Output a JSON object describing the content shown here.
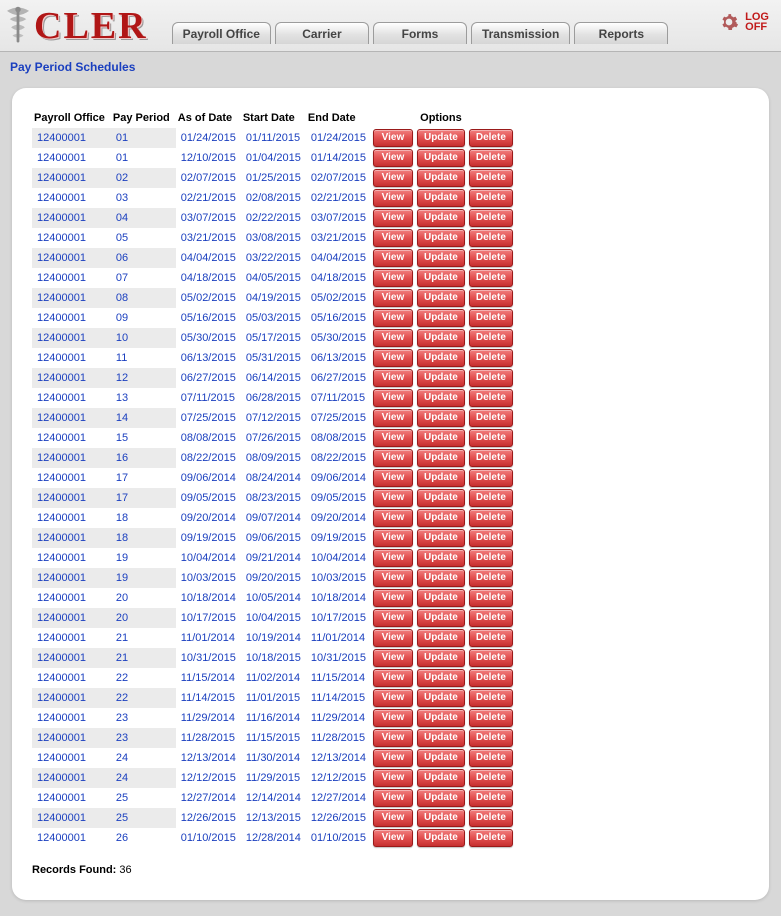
{
  "header": {
    "appName": "CLER",
    "tabs": [
      "Payroll Office",
      "Carrier",
      "Forms",
      "Transmission",
      "Reports"
    ],
    "logoff": "LOG\nOFF"
  },
  "page": {
    "subtitle": "Pay Period Schedules",
    "columns": {
      "payrollOffice": "Payroll Office",
      "payPeriod": "Pay Period",
      "asOf": "As of Date",
      "start": "Start Date",
      "end": "End Date",
      "options": "Options"
    },
    "buttons": {
      "view": "View",
      "update": "Update",
      "delete": "Delete"
    },
    "recordsLabel": "Records Found:",
    "recordsCount": "36",
    "rows": [
      {
        "po": "12400001",
        "pp": "01",
        "asof": "01/24/2015",
        "start": "01/11/2015",
        "end": "01/24/2015",
        "alt": true
      },
      {
        "po": "12400001",
        "pp": "01",
        "asof": "12/10/2015",
        "start": "01/04/2015",
        "end": "01/14/2015",
        "alt": false
      },
      {
        "po": "12400001",
        "pp": "02",
        "asof": "02/07/2015",
        "start": "01/25/2015",
        "end": "02/07/2015",
        "alt": true
      },
      {
        "po": "12400001",
        "pp": "03",
        "asof": "02/21/2015",
        "start": "02/08/2015",
        "end": "02/21/2015",
        "alt": false
      },
      {
        "po": "12400001",
        "pp": "04",
        "asof": "03/07/2015",
        "start": "02/22/2015",
        "end": "03/07/2015",
        "alt": true
      },
      {
        "po": "12400001",
        "pp": "05",
        "asof": "03/21/2015",
        "start": "03/08/2015",
        "end": "03/21/2015",
        "alt": false
      },
      {
        "po": "12400001",
        "pp": "06",
        "asof": "04/04/2015",
        "start": "03/22/2015",
        "end": "04/04/2015",
        "alt": true
      },
      {
        "po": "12400001",
        "pp": "07",
        "asof": "04/18/2015",
        "start": "04/05/2015",
        "end": "04/18/2015",
        "alt": false
      },
      {
        "po": "12400001",
        "pp": "08",
        "asof": "05/02/2015",
        "start": "04/19/2015",
        "end": "05/02/2015",
        "alt": true
      },
      {
        "po": "12400001",
        "pp": "09",
        "asof": "05/16/2015",
        "start": "05/03/2015",
        "end": "05/16/2015",
        "alt": false
      },
      {
        "po": "12400001",
        "pp": "10",
        "asof": "05/30/2015",
        "start": "05/17/2015",
        "end": "05/30/2015",
        "alt": true
      },
      {
        "po": "12400001",
        "pp": "11",
        "asof": "06/13/2015",
        "start": "05/31/2015",
        "end": "06/13/2015",
        "alt": false
      },
      {
        "po": "12400001",
        "pp": "12",
        "asof": "06/27/2015",
        "start": "06/14/2015",
        "end": "06/27/2015",
        "alt": true
      },
      {
        "po": "12400001",
        "pp": "13",
        "asof": "07/11/2015",
        "start": "06/28/2015",
        "end": "07/11/2015",
        "alt": false
      },
      {
        "po": "12400001",
        "pp": "14",
        "asof": "07/25/2015",
        "start": "07/12/2015",
        "end": "07/25/2015",
        "alt": true
      },
      {
        "po": "12400001",
        "pp": "15",
        "asof": "08/08/2015",
        "start": "07/26/2015",
        "end": "08/08/2015",
        "alt": false
      },
      {
        "po": "12400001",
        "pp": "16",
        "asof": "08/22/2015",
        "start": "08/09/2015",
        "end": "08/22/2015",
        "alt": true
      },
      {
        "po": "12400001",
        "pp": "17",
        "asof": "09/06/2014",
        "start": "08/24/2014",
        "end": "09/06/2014",
        "alt": false
      },
      {
        "po": "12400001",
        "pp": "17",
        "asof": "09/05/2015",
        "start": "08/23/2015",
        "end": "09/05/2015",
        "alt": true
      },
      {
        "po": "12400001",
        "pp": "18",
        "asof": "09/20/2014",
        "start": "09/07/2014",
        "end": "09/20/2014",
        "alt": false
      },
      {
        "po": "12400001",
        "pp": "18",
        "asof": "09/19/2015",
        "start": "09/06/2015",
        "end": "09/19/2015",
        "alt": true
      },
      {
        "po": "12400001",
        "pp": "19",
        "asof": "10/04/2014",
        "start": "09/21/2014",
        "end": "10/04/2014",
        "alt": false
      },
      {
        "po": "12400001",
        "pp": "19",
        "asof": "10/03/2015",
        "start": "09/20/2015",
        "end": "10/03/2015",
        "alt": true
      },
      {
        "po": "12400001",
        "pp": "20",
        "asof": "10/18/2014",
        "start": "10/05/2014",
        "end": "10/18/2014",
        "alt": false
      },
      {
        "po": "12400001",
        "pp": "20",
        "asof": "10/17/2015",
        "start": "10/04/2015",
        "end": "10/17/2015",
        "alt": true
      },
      {
        "po": "12400001",
        "pp": "21",
        "asof": "11/01/2014",
        "start": "10/19/2014",
        "end": "11/01/2014",
        "alt": false
      },
      {
        "po": "12400001",
        "pp": "21",
        "asof": "10/31/2015",
        "start": "10/18/2015",
        "end": "10/31/2015",
        "alt": true
      },
      {
        "po": "12400001",
        "pp": "22",
        "asof": "11/15/2014",
        "start": "11/02/2014",
        "end": "11/15/2014",
        "alt": false
      },
      {
        "po": "12400001",
        "pp": "22",
        "asof": "11/14/2015",
        "start": "11/01/2015",
        "end": "11/14/2015",
        "alt": true
      },
      {
        "po": "12400001",
        "pp": "23",
        "asof": "11/29/2014",
        "start": "11/16/2014",
        "end": "11/29/2014",
        "alt": false
      },
      {
        "po": "12400001",
        "pp": "23",
        "asof": "11/28/2015",
        "start": "11/15/2015",
        "end": "11/28/2015",
        "alt": true
      },
      {
        "po": "12400001",
        "pp": "24",
        "asof": "12/13/2014",
        "start": "11/30/2014",
        "end": "12/13/2014",
        "alt": false
      },
      {
        "po": "12400001",
        "pp": "24",
        "asof": "12/12/2015",
        "start": "11/29/2015",
        "end": "12/12/2015",
        "alt": true
      },
      {
        "po": "12400001",
        "pp": "25",
        "asof": "12/27/2014",
        "start": "12/14/2014",
        "end": "12/27/2014",
        "alt": false
      },
      {
        "po": "12400001",
        "pp": "25",
        "asof": "12/26/2015",
        "start": "12/13/2015",
        "end": "12/26/2015",
        "alt": true
      },
      {
        "po": "12400001",
        "pp": "26",
        "asof": "01/10/2015",
        "start": "12/28/2014",
        "end": "01/10/2015",
        "alt": false
      }
    ]
  }
}
